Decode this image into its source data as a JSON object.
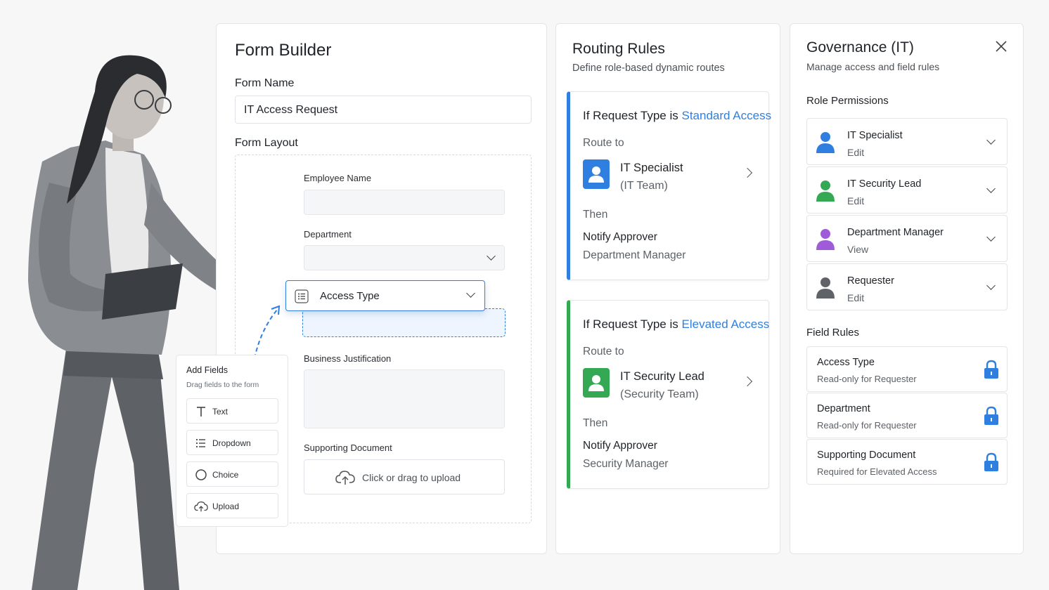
{
  "colors": {
    "accent_blue": "#2f7fe0",
    "accent_green": "#34a853",
    "role_purple": "#a05bd8",
    "role_gray": "#5f6368"
  },
  "form_builder": {
    "title": "Form Builder",
    "form_name_label": "Form Name",
    "form_name_value": "IT Access Request",
    "form_layout_label": "Form Layout",
    "fields": [
      {
        "label": "Employee Name",
        "type": "text"
      },
      {
        "label": "Department",
        "type": "dropdown"
      },
      {
        "label": "Business Justification",
        "type": "textarea"
      },
      {
        "label": "Supporting Document",
        "type": "upload"
      }
    ],
    "dragging_field": {
      "label": "Access Type",
      "icon": "list-icon"
    },
    "upload_text": "Click or drag to upload"
  },
  "add_fields": {
    "title": "Add Fields",
    "subtitle": "Drag fields to the form",
    "items": [
      {
        "label": "Text",
        "icon": "text-icon"
      },
      {
        "label": "Dropdown",
        "icon": "list-icon"
      },
      {
        "label": "Choice",
        "icon": "radio-icon"
      },
      {
        "label": "Upload",
        "icon": "cloud-upload-icon"
      }
    ]
  },
  "routing_rules": {
    "title": "Routing Rules",
    "subtitle": "Define role-based dynamic routes",
    "rules": [
      {
        "condition_prefix": "If Request Type is",
        "condition_value": "Standard Access",
        "route_label": "Route to",
        "route_name": "IT Specialist",
        "route_team": "(IT Team)",
        "then_label": "Then",
        "action": "Notify Approver",
        "action_target": "Department Manager",
        "color": "#2f7fe0"
      },
      {
        "condition_prefix": "If Request Type is",
        "condition_value": "Elevated Access",
        "route_label": "Route to",
        "route_name": "IT Security Lead",
        "route_team": "(Security Team)",
        "then_label": "Then",
        "action": "Notify Approver",
        "action_target": "Security Manager",
        "color": "#34a853"
      }
    ]
  },
  "governance": {
    "title": "Governance (IT)",
    "subtitle": "Manage access and field rules",
    "role_permissions_label": "Role Permissions",
    "roles": [
      {
        "name": "IT Specialist",
        "permission": "Edit",
        "color": "#2f7fe0"
      },
      {
        "name": "IT Security Lead",
        "permission": "Edit",
        "color": "#34a853"
      },
      {
        "name": "Department Manager",
        "permission": "View",
        "color": "#a05bd8"
      },
      {
        "name": "Requester",
        "permission": "Edit",
        "color": "#5f6368"
      }
    ],
    "field_rules_label": "Field Rules",
    "field_rules": [
      {
        "field": "Access Type",
        "rule": "Read-only for Requester"
      },
      {
        "field": "Department",
        "rule": "Read-only for Requester"
      },
      {
        "field": "Supporting Document",
        "rule": "Required for Elevated Access"
      }
    ]
  }
}
